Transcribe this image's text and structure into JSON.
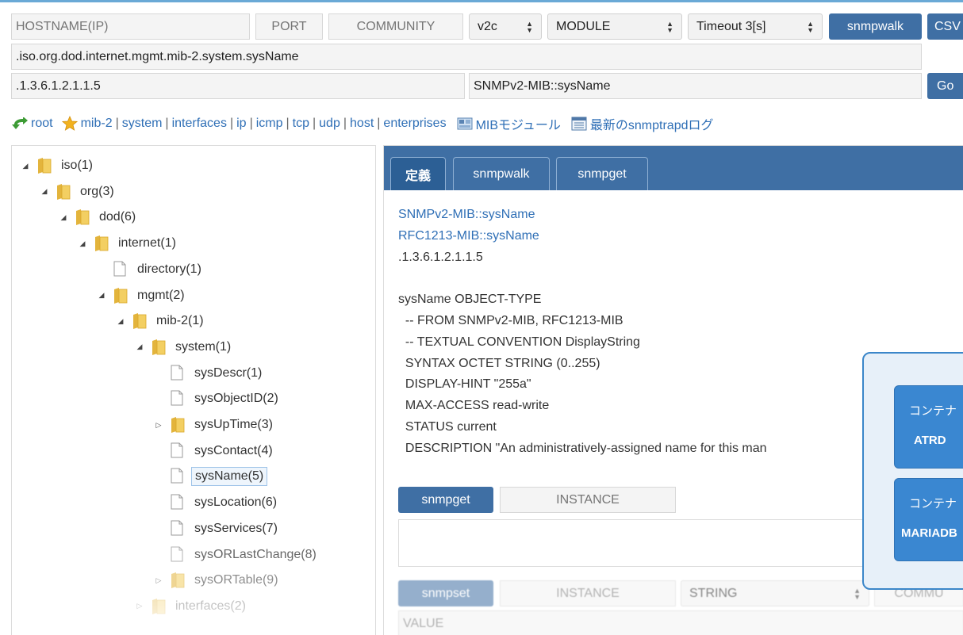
{
  "toolbar": {
    "hostname_placeholder": "HOSTNAME(IP)",
    "port_placeholder": "PORT",
    "community_placeholder": "COMMUNITY",
    "version": "v2c",
    "module": "MODULE",
    "timeout": "Timeout 3[s]",
    "snmpwalk_button": "snmpwalk",
    "csv_button": "CSV",
    "oid_path": ".iso.org.dod.internet.mgmt.mib-2.system.sysName",
    "oid_numeric": ".1.3.6.1.2.1.1.5",
    "oid_name": "SNMPv2-MIB::sysName",
    "go_button": "Go"
  },
  "nav": {
    "items": [
      {
        "icon": "green-arrow-icon",
        "label": "root"
      },
      {
        "icon": "star-icon",
        "label": "mib-2"
      },
      {
        "label": "system"
      },
      {
        "label": "interfaces"
      },
      {
        "label": "ip"
      },
      {
        "label": "icmp"
      },
      {
        "label": "tcp"
      },
      {
        "label": "udp"
      },
      {
        "label": "host"
      },
      {
        "label": "enterprises"
      }
    ],
    "mib_modules": "MIBモジュール",
    "snmptrapd_log": "最新のsnmptrapdログ"
  },
  "tree": {
    "nodes": [
      {
        "label": "iso(1)",
        "depth": 0,
        "type": "folder",
        "toggle": "expanded"
      },
      {
        "label": "org(3)",
        "depth": 1,
        "type": "folder",
        "toggle": "expanded"
      },
      {
        "label": "dod(6)",
        "depth": 2,
        "type": "folder",
        "toggle": "expanded"
      },
      {
        "label": "internet(1)",
        "depth": 3,
        "type": "folder",
        "toggle": "expanded"
      },
      {
        "label": "directory(1)",
        "depth": 4,
        "type": "file",
        "toggle": "none"
      },
      {
        "label": "mgmt(2)",
        "depth": 4,
        "type": "folder",
        "toggle": "expanded"
      },
      {
        "label": "mib-2(1)",
        "depth": 5,
        "type": "folder",
        "toggle": "expanded"
      },
      {
        "label": "system(1)",
        "depth": 6,
        "type": "folder",
        "toggle": "expanded"
      },
      {
        "label": "sysDescr(1)",
        "depth": 7,
        "type": "file",
        "toggle": "none"
      },
      {
        "label": "sysObjectID(2)",
        "depth": 7,
        "type": "file",
        "toggle": "none"
      },
      {
        "label": "sysUpTime(3)",
        "depth": 7,
        "type": "folder",
        "toggle": "collapsed"
      },
      {
        "label": "sysContact(4)",
        "depth": 7,
        "type": "file",
        "toggle": "none"
      },
      {
        "label": "sysName(5)",
        "depth": 7,
        "type": "file",
        "toggle": "none",
        "selected": true
      },
      {
        "label": "sysLocation(6)",
        "depth": 7,
        "type": "file",
        "toggle": "none"
      },
      {
        "label": "sysServices(7)",
        "depth": 7,
        "type": "file",
        "toggle": "none"
      },
      {
        "label": "sysORLastChange(8)",
        "depth": 7,
        "type": "file",
        "toggle": "none"
      },
      {
        "label": "sysORTable(9)",
        "depth": 7,
        "type": "folder",
        "toggle": "collapsed"
      },
      {
        "label": "interfaces(2)",
        "depth": 6,
        "type": "folder",
        "toggle": "collapsed"
      }
    ]
  },
  "panel": {
    "tabs": [
      {
        "label": "定義",
        "active": true
      },
      {
        "label": "snmpwalk",
        "active": false
      },
      {
        "label": "snmpget",
        "active": false
      }
    ],
    "links": [
      "SNMPv2-MIB::sysName",
      "RFC1213-MIB::sysName"
    ],
    "oid": ".1.3.6.1.2.1.1.5",
    "definition_lines": [
      "sysName OBJECT-TYPE",
      "  -- FROM SNMPv2-MIB, RFC1213-MIB",
      "  -- TEXTUAL CONVENTION DisplayString",
      "  SYNTAX OCTET STRING (0..255)",
      "  DISPLAY-HINT \"255a\"",
      "  MAX-ACCESS read-write",
      "  STATUS current",
      "  DESCRIPTION \"An administratively-assigned name for this man"
    ],
    "snmpget_button": "snmpget",
    "instance_placeholder": "INSTANCE",
    "snmpset_button": "snmpset",
    "set_instance_placeholder": "INSTANCE",
    "set_type": "STRING",
    "set_community_placeholder": "COMMU",
    "value_placeholder": "VALUE"
  },
  "overlay": {
    "containers": [
      {
        "title": "コンテナ",
        "name": "ATRD"
      },
      {
        "title": "コンテナ",
        "name": "MARIADB"
      }
    ]
  },
  "colors": {
    "accent": "#3f6fa4",
    "link": "#2f6fb6",
    "overlay_border": "#3b86c9",
    "container_fill": "#3a87d1"
  }
}
